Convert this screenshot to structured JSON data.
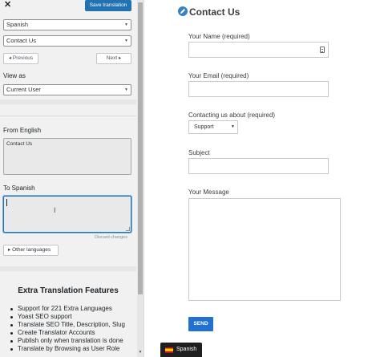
{
  "sidebar": {
    "save_label": "Save translation",
    "language_select": "Spanish",
    "string_select": "Contact Us",
    "previous_label": "◂ Previous",
    "next_label": "Next ▸",
    "view_as_label": "View as",
    "view_as_select": "Current User",
    "from_label": "From English",
    "from_text": "Contact Us",
    "to_label": "To Spanish",
    "to_text": "",
    "discard_label": "Discard changes",
    "other_languages_label": "▸ Other languages",
    "extra_title": "Extra Translation Features",
    "extra_items": [
      "Support for 221 Extra Languages",
      "Yoast SEO support",
      "Translate SEO Title, Description, Slug",
      "Create Translator Accounts",
      "Publish only when translation is done",
      "Translate by Browsing as User Role"
    ]
  },
  "preview": {
    "page_title": "Contact Us",
    "name_label": "Your Name (required)",
    "email_label": "Your Email (required)",
    "about_label": "Contacting us about (required)",
    "about_select": "Support",
    "subject_label": "Subject",
    "message_label": "Your Message",
    "send_label": "SEND"
  },
  "language_switcher": {
    "label": "Spanish"
  },
  "colors": {
    "accent": "#2271b1",
    "send_button": "#2271d1",
    "switcher_bg": "#1f1f1f"
  },
  "icons": [
    "close-icon",
    "pencil-icon",
    "keypad-icon",
    "spanish-flag-icon",
    "chevron-down-icon",
    "text-cursor-icon"
  ]
}
